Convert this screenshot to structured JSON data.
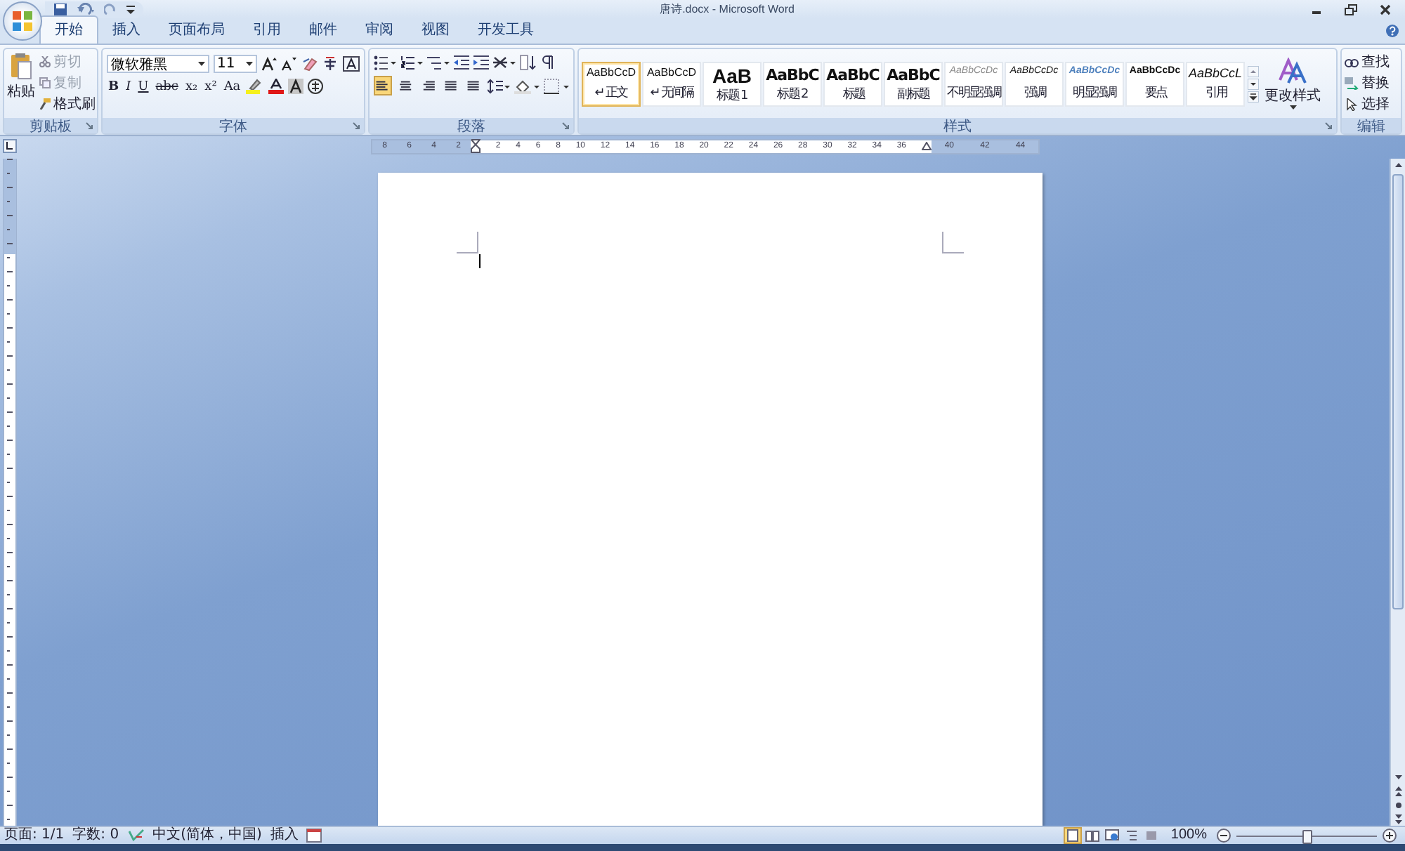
{
  "window": {
    "title": "唐诗.docx - Microsoft Word"
  },
  "tabs": [
    {
      "label": "开始",
      "selected": true
    },
    {
      "label": "插入",
      "selected": false
    },
    {
      "label": "页面布局",
      "selected": false
    },
    {
      "label": "引用",
      "selected": false
    },
    {
      "label": "邮件",
      "selected": false
    },
    {
      "label": "审阅",
      "selected": false
    },
    {
      "label": "视图",
      "selected": false
    },
    {
      "label": "开发工具",
      "selected": false
    }
  ],
  "clipboard": {
    "title": "剪贴板",
    "paste": "粘贴",
    "items": [
      {
        "label": "剪切",
        "kind": "cut",
        "disabled": true
      },
      {
        "label": "复制",
        "kind": "copy",
        "disabled": true
      },
      {
        "label": "格式刷",
        "kind": "brush",
        "disabled": false
      }
    ]
  },
  "font": {
    "title": "字体",
    "font_name": "微软雅黑",
    "font_size": "11",
    "format_buttons": [
      {
        "label": "B",
        "kind": "bold"
      },
      {
        "label": "I",
        "kind": "italic"
      },
      {
        "label": "U",
        "kind": "underline"
      },
      {
        "label": "abc",
        "kind": "strike"
      },
      {
        "label": "x₂",
        "kind": "plain"
      },
      {
        "label": "x²",
        "kind": "plain"
      },
      {
        "label": "Aa",
        "kind": "plain"
      }
    ]
  },
  "paragraph": {
    "title": "段落",
    "alignments": [
      {
        "kind": "left",
        "selected": true
      },
      {
        "kind": "center",
        "selected": false
      },
      {
        "kind": "right",
        "selected": false
      },
      {
        "kind": "justify",
        "selected": false
      },
      {
        "kind": "distributed",
        "selected": false
      }
    ]
  },
  "styles": {
    "title": "样式",
    "change_label": "更改样式",
    "items": [
      {
        "preview": "AaBbCcD",
        "name": "↵ 正文",
        "kind": "normal",
        "selected": true
      },
      {
        "preview": "AaBbCcD",
        "name": "↵ 无间隔",
        "kind": "normal",
        "selected": false
      },
      {
        "preview": "AaB",
        "name": "标题 1",
        "kind": "h1",
        "selected": false
      },
      {
        "preview": "AaBbC",
        "name": "标题 2",
        "kind": "h2",
        "selected": false
      },
      {
        "preview": "AaBbC",
        "name": "标题",
        "kind": "h2",
        "selected": false
      },
      {
        "preview": "AaBbC",
        "name": "副标题",
        "kind": "h2",
        "selected": false
      },
      {
        "preview": "AaBbCcDc",
        "name": "不明显强调",
        "kind": "subtle",
        "selected": false
      },
      {
        "preview": "AaBbCcDc",
        "name": "强调",
        "kind": "emphasis",
        "selected": false
      },
      {
        "preview": "AaBbCcDc",
        "name": "明显强调",
        "kind": "intense",
        "selected": false
      },
      {
        "preview": "AaBbCcDc",
        "name": "要点",
        "kind": "strong",
        "selected": false
      },
      {
        "preview": "AaBbCcL",
        "name": "引用",
        "kind": "quote",
        "selected": false
      }
    ]
  },
  "editing": {
    "title": "编辑",
    "items": [
      {
        "label": "查找",
        "kind": "find"
      },
      {
        "label": "替换",
        "kind": "replace"
      },
      {
        "label": "选择",
        "kind": "select"
      }
    ]
  },
  "ruler": {
    "left_numbers": [
      "8",
      "6",
      "4",
      "2"
    ],
    "middle_numbers": [
      "2",
      "4",
      "6",
      "8",
      "10",
      "12",
      "14",
      "16",
      "18",
      "20",
      "22",
      "24",
      "26",
      "28",
      "30",
      "32",
      "34",
      "36"
    ],
    "right_numbers": [
      "40",
      "42",
      "44"
    ]
  },
  "status_bar": {
    "page": "页面: 1/1",
    "words": "字数: 0",
    "language": "中文(简体，中国)",
    "mode": "插入",
    "zoom": "100%",
    "zoom_slider": {
      "level": 0.5
    },
    "views": [
      {
        "kind": "print",
        "selected": true
      },
      {
        "kind": "read",
        "selected": false
      },
      {
        "kind": "web",
        "selected": false
      },
      {
        "kind": "outline",
        "selected": false
      },
      {
        "kind": "draft",
        "selected": false
      }
    ]
  }
}
